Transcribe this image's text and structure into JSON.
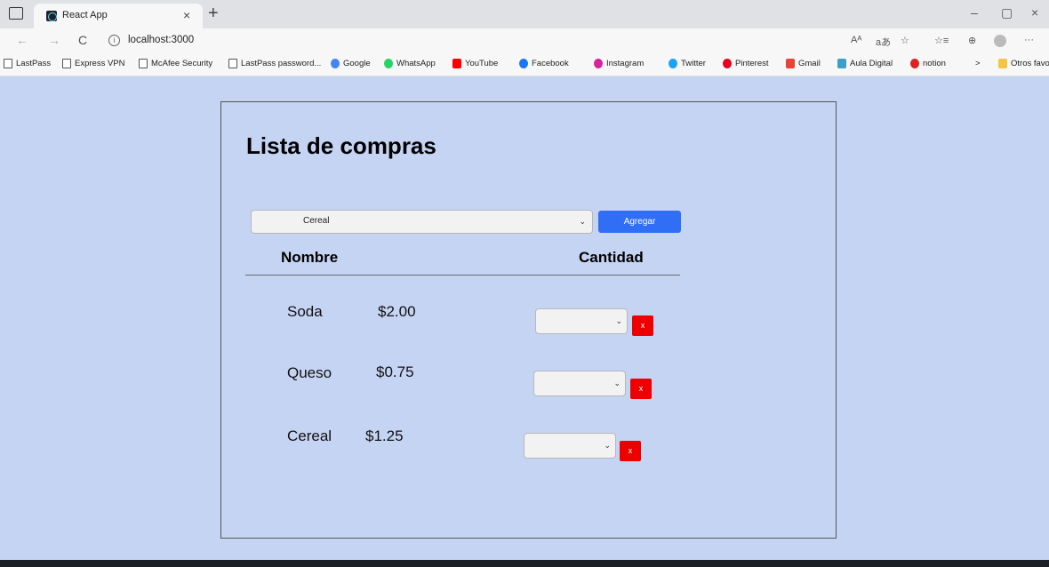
{
  "browser": {
    "tab_title": "React App",
    "tab_close": "×",
    "new_tab": "+",
    "url": "localhost:3000",
    "back": "←",
    "forward": "→",
    "reload": "C",
    "info": "i",
    "minimize": "–",
    "restore": "▢",
    "close": "×",
    "toolbar_read": "Aᴬ",
    "toolbar_translate": "aあ",
    "toolbar_fav": "☆",
    "toolbar_favs": "☆≡",
    "toolbar_collections": "⊕",
    "toolbar_more": "···",
    "bookmarks": [
      "LastPass",
      "Express VPN",
      "McAfee Security",
      "LastPass password...",
      "Google",
      "WhatsApp",
      "YouTube",
      "Facebook",
      "Instagram",
      "Twitter",
      "Pinterest",
      "Gmail",
      "Aula Digital",
      "notion"
    ],
    "bookmarks_more": ">",
    "other_favorites": "Otros favoritos"
  },
  "app": {
    "title": "Lista de compras",
    "select_value": "Cereal",
    "add_button": "Agregar",
    "col_name": "Nombre",
    "col_qty": "Cantidad",
    "delete_label": "x",
    "items": [
      {
        "name": "Soda",
        "price": "$2.00"
      },
      {
        "name": "Queso",
        "price": "$0.75"
      },
      {
        "name": "Cereal",
        "price": "$1.25"
      }
    ]
  },
  "colors": {
    "page_bg": "#c6d4f4",
    "add_button": "#2f6ef5",
    "delete_button": "#ee0000"
  }
}
